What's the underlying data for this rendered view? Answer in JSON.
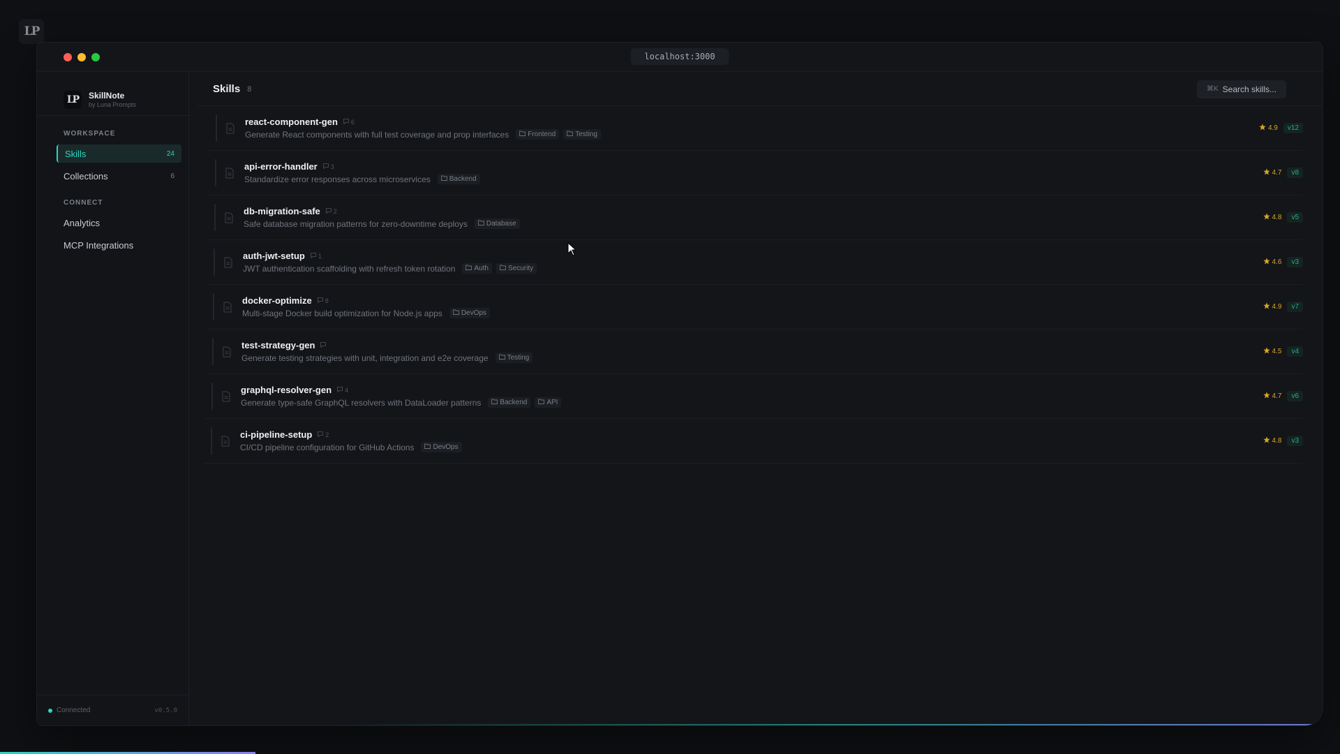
{
  "url": "localhost:3000",
  "brand": {
    "name": "SkillNote",
    "subtitle": "by Luna Prompts"
  },
  "sidebar": {
    "sections": [
      {
        "label": "WORKSPACE",
        "items": [
          {
            "label": "Skills",
            "count": "24",
            "active": true
          },
          {
            "label": "Collections",
            "count": "6",
            "active": false
          }
        ]
      },
      {
        "label": "CONNECT",
        "items": [
          {
            "label": "Analytics",
            "count": "",
            "active": false
          },
          {
            "label": "MCP Integrations",
            "count": "",
            "active": false
          }
        ]
      }
    ],
    "status": "Connected",
    "version": "v0.5.0"
  },
  "header": {
    "title": "Skills",
    "count": "8",
    "search_shortcut": "⌘K",
    "search_label": "Search skills..."
  },
  "skills": [
    {
      "name": "react-component-gen",
      "comments": "6",
      "description": "Generate React components with full test coverage and prop interfaces",
      "tags": [
        "Frontend",
        "Testing"
      ],
      "rating": "4.9",
      "version": "v12"
    },
    {
      "name": "api-error-handler",
      "comments": "3",
      "description": "Standardize error responses across microservices",
      "tags": [
        "Backend"
      ],
      "rating": "4.7",
      "version": "v8"
    },
    {
      "name": "db-migration-safe",
      "comments": "2",
      "description": "Safe database migration patterns for zero-downtime deploys",
      "tags": [
        "Database"
      ],
      "rating": "4.8",
      "version": "v5"
    },
    {
      "name": "auth-jwt-setup",
      "comments": "1",
      "description": "JWT authentication scaffolding with refresh token rotation",
      "tags": [
        "Auth",
        "Security"
      ],
      "rating": "4.6",
      "version": "v3"
    },
    {
      "name": "docker-optimize",
      "comments": "8",
      "description": "Multi-stage Docker build optimization for Node.js apps",
      "tags": [
        "DevOps"
      ],
      "rating": "4.9",
      "version": "v7"
    },
    {
      "name": "test-strategy-gen",
      "comments": "",
      "description": "Generate testing strategies with unit, integration and e2e coverage",
      "tags": [
        "Testing"
      ],
      "rating": "4.5",
      "version": "v4"
    },
    {
      "name": "graphql-resolver-gen",
      "comments": "4",
      "description": "Generate type-safe GraphQL resolvers with DataLoader patterns",
      "tags": [
        "Backend",
        "API"
      ],
      "rating": "4.7",
      "version": "v6"
    },
    {
      "name": "ci-pipeline-setup",
      "comments": "2",
      "description": "CI/CD pipeline configuration for GitHub Actions",
      "tags": [
        "DevOps"
      ],
      "rating": "4.8",
      "version": "v3"
    }
  ],
  "colors": {
    "accent": "#2dd4bf",
    "star": "#d6a52a",
    "background": "#0e1013",
    "panel": "#131519"
  },
  "icons": [
    "lp-logo",
    "document-icon",
    "comment-icon",
    "folder-icon",
    "star-icon",
    "cursor-icon"
  ]
}
